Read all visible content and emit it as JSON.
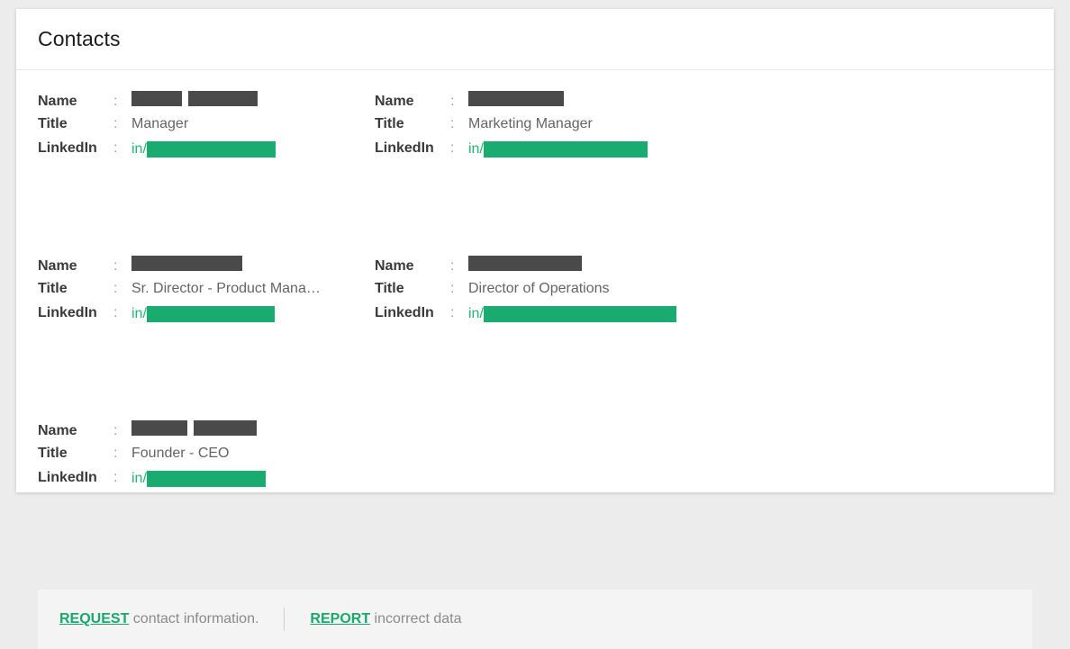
{
  "card": {
    "title": "Contacts"
  },
  "labels": {
    "name": "Name",
    "title": "Title",
    "linkedin": "LinkedIn",
    "colon": ":",
    "linkedin_prefix": "in/"
  },
  "contacts": [
    {
      "name_redacted": true,
      "name_blocks": [
        56,
        77
      ],
      "title": "Manager",
      "linkedin_bar_width": 143
    },
    {
      "name_redacted": true,
      "name_blocks": [
        106
      ],
      "title": "Marketing Manager",
      "linkedin_bar_width": 182
    },
    {
      "name_redacted": true,
      "name_blocks": [
        123
      ],
      "title": "Sr. Director - Product Mana…",
      "linkedin_bar_width": 142
    },
    {
      "name_redacted": true,
      "name_blocks": [
        126
      ],
      "title": "Director of Operations",
      "linkedin_bar_width": 214
    },
    {
      "name_redacted": true,
      "name_blocks": [
        62,
        70
      ],
      "title": "Founder - CEO",
      "linkedin_bar_width": 132
    }
  ],
  "footer": {
    "request_link": "REQUEST",
    "request_text": " contact information.",
    "report_link": "REPORT",
    "report_text": " incorrect data"
  },
  "colors": {
    "accent_green": "#1aa86b",
    "redaction_dark": "#4a4a4a",
    "redaction_green": "#19ab70",
    "page_background": "#ececec",
    "footer_background": "#f4f4f4"
  }
}
